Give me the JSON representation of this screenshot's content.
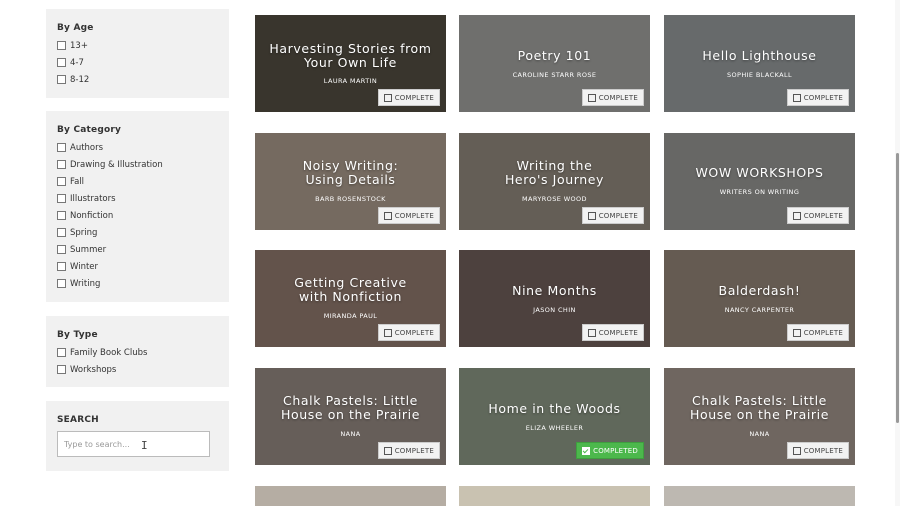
{
  "filters": {
    "age": {
      "title": "By Age",
      "options": [
        "13+",
        "4-7",
        "8-12"
      ]
    },
    "category": {
      "title": "By Category",
      "options": [
        "Authors",
        "Drawing & Illustration",
        "Fall",
        "Illustrators",
        "Nonfiction",
        "Spring",
        "Summer",
        "Winter",
        "Writing"
      ]
    },
    "type": {
      "title": "By Type",
      "options": [
        "Family Book Clubs",
        "Workshops"
      ]
    },
    "search": {
      "title": "SEARCH",
      "placeholder": "Type to search..."
    }
  },
  "cards": [
    {
      "title": "Harvesting Stories from Your Own Life",
      "author": "LAURA MARTIN",
      "status": "COMPLETE",
      "completed": false,
      "bg": "#4f4a3f"
    },
    {
      "title": "Poetry 101",
      "author": "CAROLINE STARR ROSE",
      "status": "COMPLETE",
      "completed": false,
      "bg": "#9a9a97"
    },
    {
      "title": "Hello Lighthouse",
      "author": "SOPHIE BLACKALL",
      "status": "COMPLETE",
      "completed": false,
      "bg": "#8f9495"
    },
    {
      "title": "Noisy Writing: Using Details",
      "author": "BARB ROSENSTOCK",
      "status": "COMPLETE",
      "completed": false,
      "bg": "#a39486"
    },
    {
      "title": "Writing the Hero's Journey",
      "author": "MARYROSE WOOD",
      "status": "COMPLETE",
      "completed": false,
      "bg": "#8b8378"
    },
    {
      "title": "WOW WORKSHOPS",
      "author": "WRITERS ON WRITING",
      "status": "COMPLETE",
      "completed": false,
      "bg": "#8f8f8c"
    },
    {
      "title": "Getting Creative with Nonfiction",
      "author": "MIRANDA PAUL",
      "status": "COMPLETE",
      "completed": false,
      "bg": "#8a7468"
    },
    {
      "title": "Nine Months",
      "author": "JASON CHIN",
      "status": "COMPLETE",
      "completed": false,
      "bg": "#6b5b57"
    },
    {
      "title": "Balderdash!",
      "author": "NANCY CARPENTER",
      "status": "COMPLETE",
      "completed": false,
      "bg": "#8c7f72"
    },
    {
      "title": "Chalk Pastels: Little House on the Prairie",
      "author": "NANA",
      "status": "COMPLETE",
      "completed": false,
      "bg": "#8e837c"
    },
    {
      "title": "Home in the Woods",
      "author": "ELIZA WHEELER",
      "status": "COMPLETED",
      "completed": true,
      "bg": "#85907e"
    },
    {
      "title": "Chalk Pastels: Little House on the Prairie",
      "author": "NANA",
      "status": "COMPLETE",
      "completed": false,
      "bg": "#9a8e86"
    },
    {
      "title": "",
      "author": "",
      "status": "",
      "completed": false,
      "bg": "#b5ada3"
    },
    {
      "title": "",
      "author": "",
      "status": "",
      "completed": false,
      "bg": "#c9c2b1"
    },
    {
      "title": "",
      "author": "",
      "status": "",
      "completed": false,
      "bg": "#bdb8b1"
    }
  ]
}
